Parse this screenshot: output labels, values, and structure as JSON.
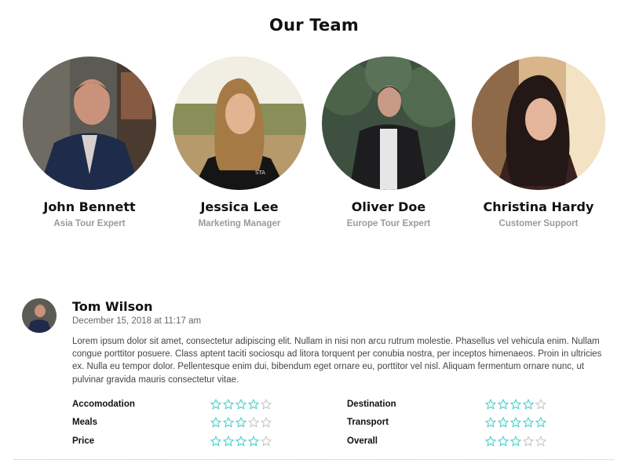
{
  "section": {
    "title": "Our Team"
  },
  "team": [
    {
      "name": "John Bennett",
      "role": "Asia Tour Expert"
    },
    {
      "name": "Jessica Lee",
      "role": "Marketing Manager"
    },
    {
      "name": "Oliver Doe",
      "role": "Europe Tour Expert"
    },
    {
      "name": "Christina Hardy",
      "role": "Customer Support"
    }
  ],
  "review": {
    "author": "Tom Wilson",
    "date": "December 15, 2018 at 11:17 am",
    "text": "Lorem ipsum dolor sit amet, consectetur adipiscing elit. Nullam in nisi non arcu rutrum molestie. Phasellus vel vehicula enim. Nullam congue porttitor posuere. Class aptent taciti sociosqu ad litora torquent per conubia nostra, per inceptos himenaeos. Proin in ultricies ex. Nulla eu tempor dolor. Pellentesque enim dui, bibendum eget ornare eu, porttitor vel nisl. Aliquam fermentum ornare nunc, ut pulvinar gravida mauris consectetur vitae.",
    "ratings": [
      {
        "label": "Accomodation",
        "stars": 4,
        "max": 5
      },
      {
        "label": "Destination",
        "stars": 4,
        "max": 5
      },
      {
        "label": "Meals",
        "stars": 3,
        "max": 5
      },
      {
        "label": "Transport",
        "stars": 5,
        "max": 5
      },
      {
        "label": "Price",
        "stars": 4,
        "max": 5
      },
      {
        "label": "Overall",
        "stars": 3,
        "max": 5
      }
    ]
  },
  "colors": {
    "star_filled": "#4dd0c8",
    "star_empty": "#c8c8c8",
    "role_text": "#9a9a9a"
  },
  "icons": {
    "rating_star": "star-icon"
  }
}
